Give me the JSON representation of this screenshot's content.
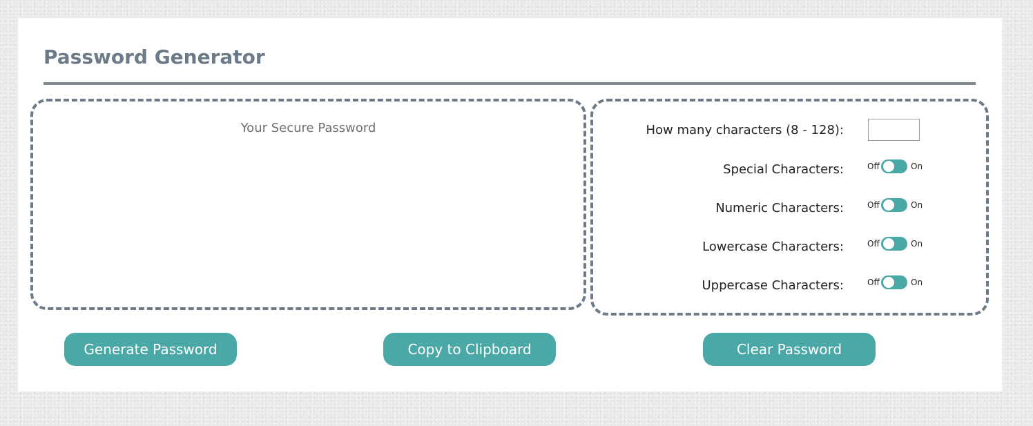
{
  "app": {
    "title": "Password Generator"
  },
  "password": {
    "placeholder": "Your Secure Password",
    "value": ""
  },
  "criteria": {
    "length": {
      "label": "How many characters (8 - 128):",
      "value": ""
    },
    "toggle_off_label": "Off",
    "toggle_on_label": "On",
    "options": [
      {
        "label": "Special Characters:",
        "enabled": false
      },
      {
        "label": "Numeric Characters:",
        "enabled": false
      },
      {
        "label": "Lowercase Characters:",
        "enabled": false
      },
      {
        "label": "Uppercase Characters:",
        "enabled": false
      }
    ]
  },
  "buttons": {
    "generate": "Generate Password",
    "copy": "Copy to Clipboard",
    "clear": "Clear Password"
  },
  "colors": {
    "accent": "#4aa8a6",
    "heading": "#6c7a89",
    "border": "#6c7a89"
  },
  "icons": {
    "toggle_knob": "toggle-knob-icon"
  }
}
